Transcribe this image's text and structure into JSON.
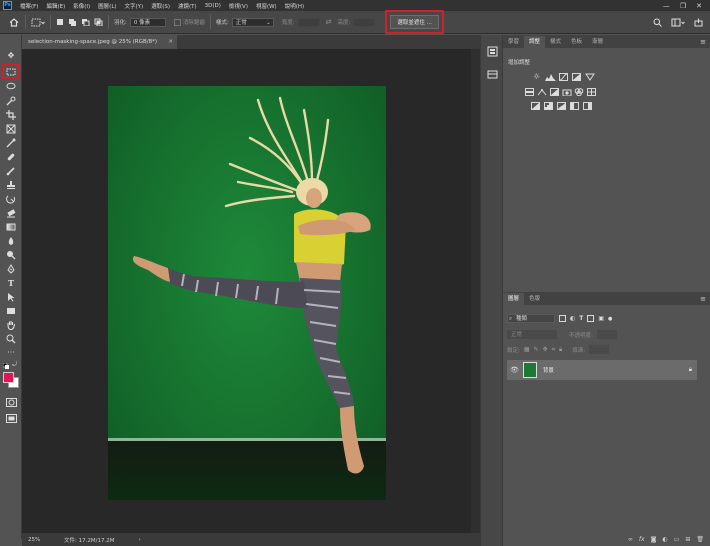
{
  "app": {
    "logo": "Ps"
  },
  "menu": [
    "檔案(F)",
    "編輯(E)",
    "影像(I)",
    "圖層(L)",
    "文字(Y)",
    "選取(S)",
    "濾鏡(T)",
    "3D(D)",
    "檢視(V)",
    "視窗(W)",
    "說明(H)"
  ],
  "window_controls": {
    "minimize": "—",
    "maximize": "❐",
    "close": "✕"
  },
  "options": {
    "feather_label": "羽化:",
    "feather_value": "0 像素",
    "antialias_label": "消除鋸齒",
    "style_label": "樣式:",
    "style_value": "正常",
    "width_label": "寬度:",
    "height_label": "高度:",
    "select_mask_label": "選取並遮住 ..."
  },
  "document": {
    "tab_title": "selection-masking-space.jpeg @ 25% (RGB/8*)",
    "zoom": "25%",
    "doc_size": "文件: 17.2M/17.2M"
  },
  "adjust_panel": {
    "tabs": [
      "學習",
      "調整",
      "樣式",
      "色板",
      "漸層"
    ],
    "active_tab": 1,
    "heading": "增加調整"
  },
  "layers_panel": {
    "tabs": [
      "圖層",
      "色版"
    ],
    "active_tab": 0,
    "kind_placeholder": "種類",
    "blend_mode": "正常",
    "opacity_label": "不透明度:",
    "lock_label": "鎖定:",
    "fill_label": "填滿:",
    "layer_name": "背景"
  },
  "colors": {
    "foreground": "#e2145a",
    "background": "#ffffff",
    "highlight": "#d0202c"
  }
}
